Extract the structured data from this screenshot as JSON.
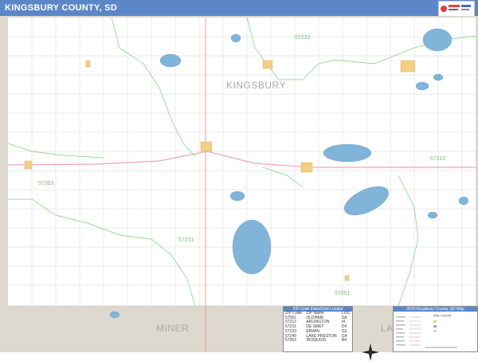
{
  "header": {
    "title": "KINGSBURY COUNTY, SD",
    "bar_color": "#5b87c9"
  },
  "map": {
    "county_name": "KINGSBURY",
    "neighbor_county": "MINER",
    "neighbor_county_partial": "LA",
    "zip_labels": [
      "57233",
      "57353",
      "57212",
      "57231",
      "57051"
    ],
    "colors": {
      "county_fill": "#ffffff",
      "outside_fill": "#ddd9cf",
      "water": "#80b4d8",
      "zip_boundary": "#79d179",
      "highway": "#f2a3b8",
      "county_line": "#e8836a",
      "road_grid": "#d0d0d0",
      "town": "#f2cf84"
    },
    "icons": [
      "compass-rose-icon",
      "logo-icon"
    ]
  },
  "zip_locator": {
    "title": "ZIP Code Index/Grid Locator",
    "headers": [
      "ZIP Code",
      "ZIP Name",
      "LOC"
    ],
    "rows": [
      [
        "57051",
        "OLDHAM",
        "G6"
      ],
      [
        "57212",
        "ARLINGTON",
        "I4"
      ],
      [
        "57231",
        "DE SMET",
        "D4"
      ],
      [
        "57233",
        "ERWIN",
        "G2"
      ],
      [
        "57249",
        "LAKE PRESTON",
        "G4"
      ],
      [
        "57353",
        "IROQUOIS",
        "B4"
      ]
    ]
  },
  "legend": {
    "title": "2019 Kingsbury County, SD Map",
    "subtitle": "Map Legend"
  }
}
